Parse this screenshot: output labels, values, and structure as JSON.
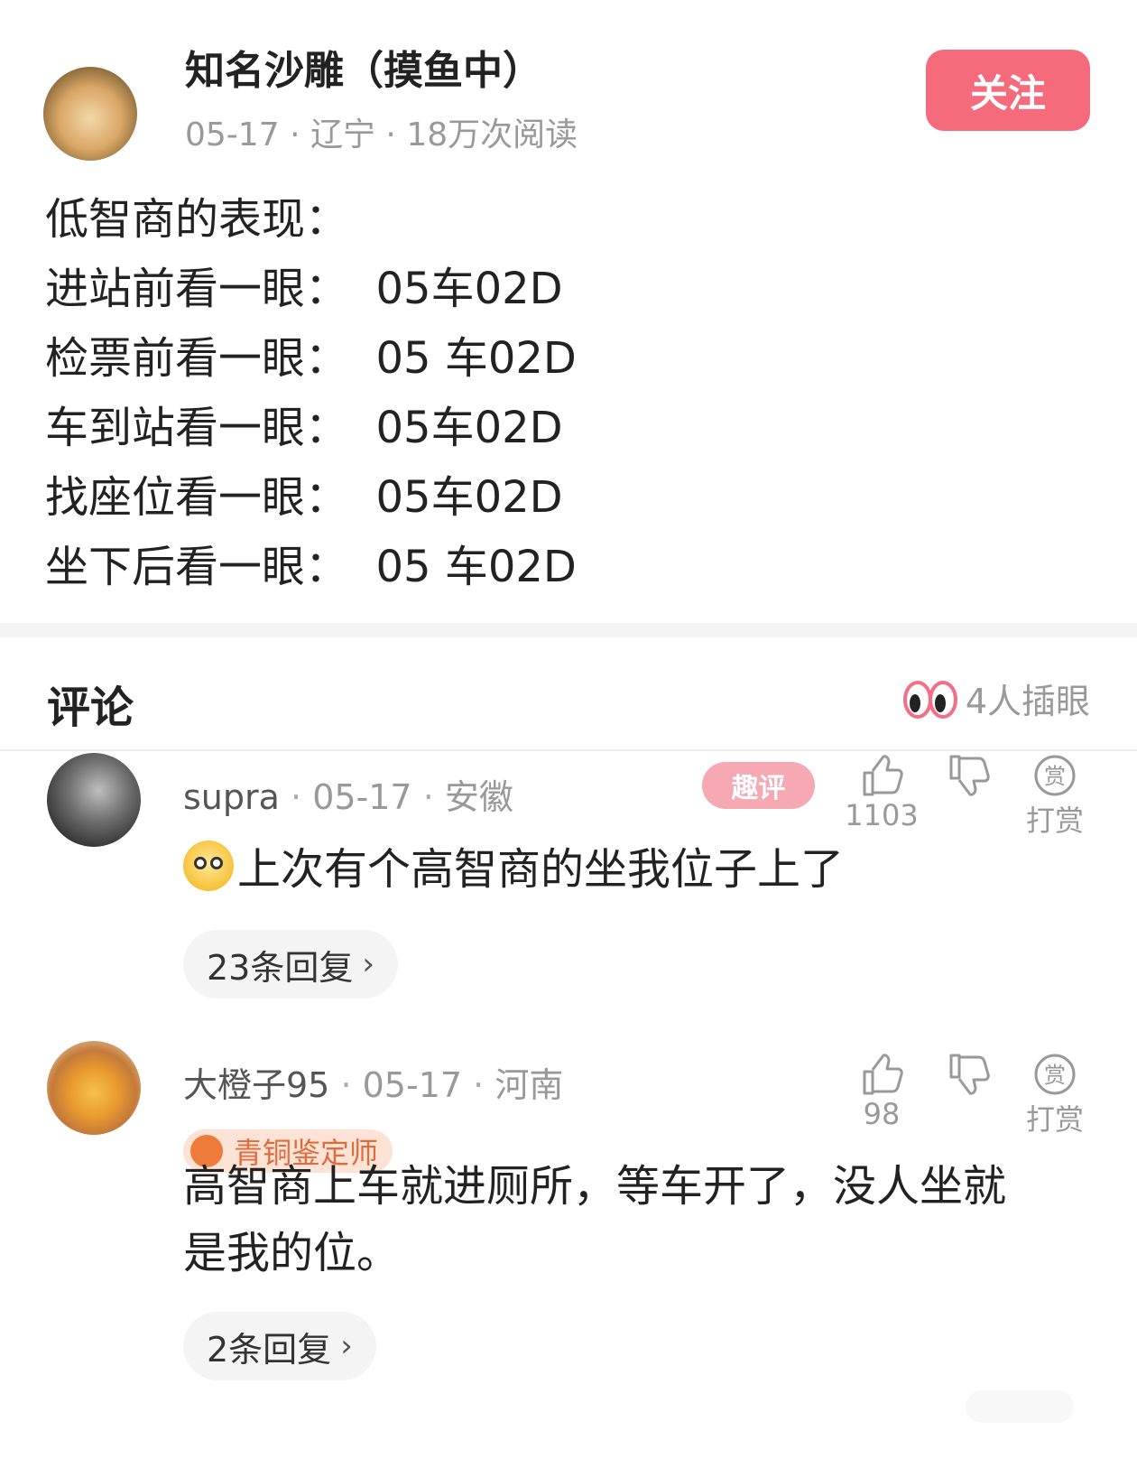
{
  "post": {
    "author_name": "知名沙雕（摸鱼中）",
    "date": "05-17",
    "location": "辽宁",
    "reads": "18万次阅读",
    "follow_label": "关注",
    "lines": [
      "低智商的表现：",
      "进站前看一眼：  05车02D",
      "检票前看一眼：  05 车02D",
      "车到站看一眼：  05车02D",
      "找座位看一眼：  05车02D",
      "坐下后看一眼：  05 车02D"
    ]
  },
  "comments_section": {
    "title": "评论",
    "peek_text": "4人插眼"
  },
  "comments": [
    {
      "user": "supra",
      "date": "05-17",
      "location": "安徽",
      "badge": "趣评",
      "likes": "1103",
      "tip_label": "打赏",
      "text": "上次有个高智商的坐我位子上了",
      "replies": "23条回复"
    },
    {
      "user": "大橙子95",
      "date": "05-17",
      "location": "河南",
      "title_badge": "青铜鉴定师",
      "likes": "98",
      "tip_label": "打赏",
      "text_line1": "高智商上车就进厕所，等车开了，没人坐就",
      "text_line2": "是我的位。",
      "replies": "2条回复"
    }
  ],
  "colors": {
    "accent": "#f66b7c",
    "muted": "#999999",
    "bronze": "#e06b3c"
  },
  "icons": [
    "thumbs-up-icon",
    "thumbs-down-icon",
    "reward-icon",
    "eyes-icon",
    "chevron-right-icon"
  ]
}
